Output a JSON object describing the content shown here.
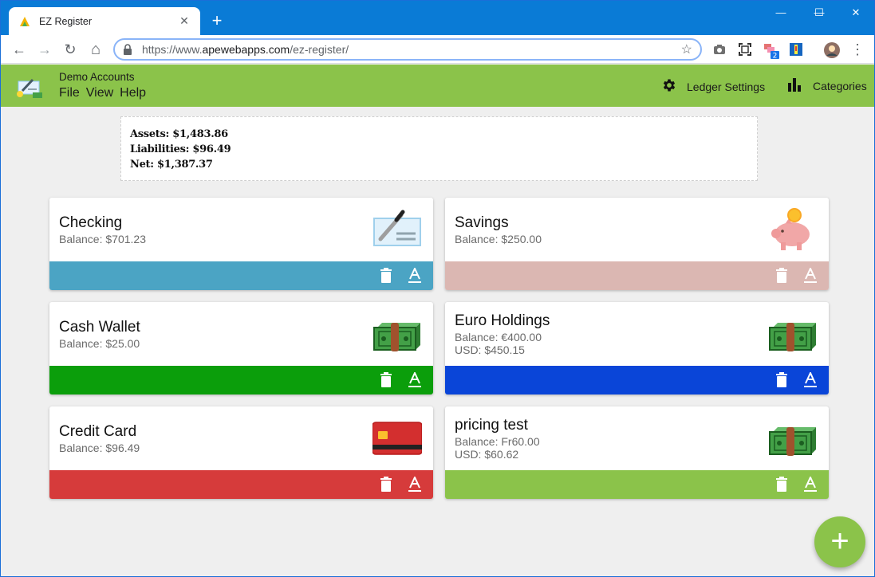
{
  "browser": {
    "tab_title": "EZ Register",
    "tab_close": "✕",
    "new_tab": "+",
    "url_prefix": "https://www.",
    "url_domain": "apewebapps.com",
    "url_path": "/ez-register/",
    "win_minimize": "—",
    "win_maximize": "☐",
    "win_close": "✕",
    "nav_back": "←",
    "nav_forward": "→",
    "nav_reload": "↻",
    "nav_home": "⌂",
    "star": "☆",
    "menu": "⋮"
  },
  "app": {
    "title": "Demo Accounts",
    "menu": [
      "File",
      "View",
      "Help"
    ],
    "ledger_settings": "Ledger Settings",
    "categories": "Categories",
    "fab": "+"
  },
  "summary": {
    "assets": "Assets: $1,483.86",
    "liabilities": "Liabilities: $96.49",
    "net": "Net: $1,387.37"
  },
  "accounts": [
    {
      "name": "Checking",
      "lines": [
        "Balance: $701.23"
      ],
      "color": "#4ba4c4",
      "icon": "check-icon"
    },
    {
      "name": "Savings",
      "lines": [
        "Balance: $250.00"
      ],
      "color": "#dbb7b2",
      "icon": "piggy-bank-icon"
    },
    {
      "name": "Cash Wallet",
      "lines": [
        "Balance: $25.00"
      ],
      "color": "#0b9e0b",
      "icon": "cash-icon"
    },
    {
      "name": "Euro Holdings",
      "lines": [
        "Balance: €400.00",
        "USD: $450.15"
      ],
      "color": "#0a45d8",
      "icon": "cash-icon"
    },
    {
      "name": "Credit Card",
      "lines": [
        "Balance: $96.49"
      ],
      "color": "#d63b3b",
      "icon": "credit-card-icon"
    },
    {
      "name": "pricing test",
      "lines": [
        "Balance: Fr60.00",
        "USD: $60.62"
      ],
      "color": "#8bc34a",
      "icon": "cash-icon"
    }
  ]
}
